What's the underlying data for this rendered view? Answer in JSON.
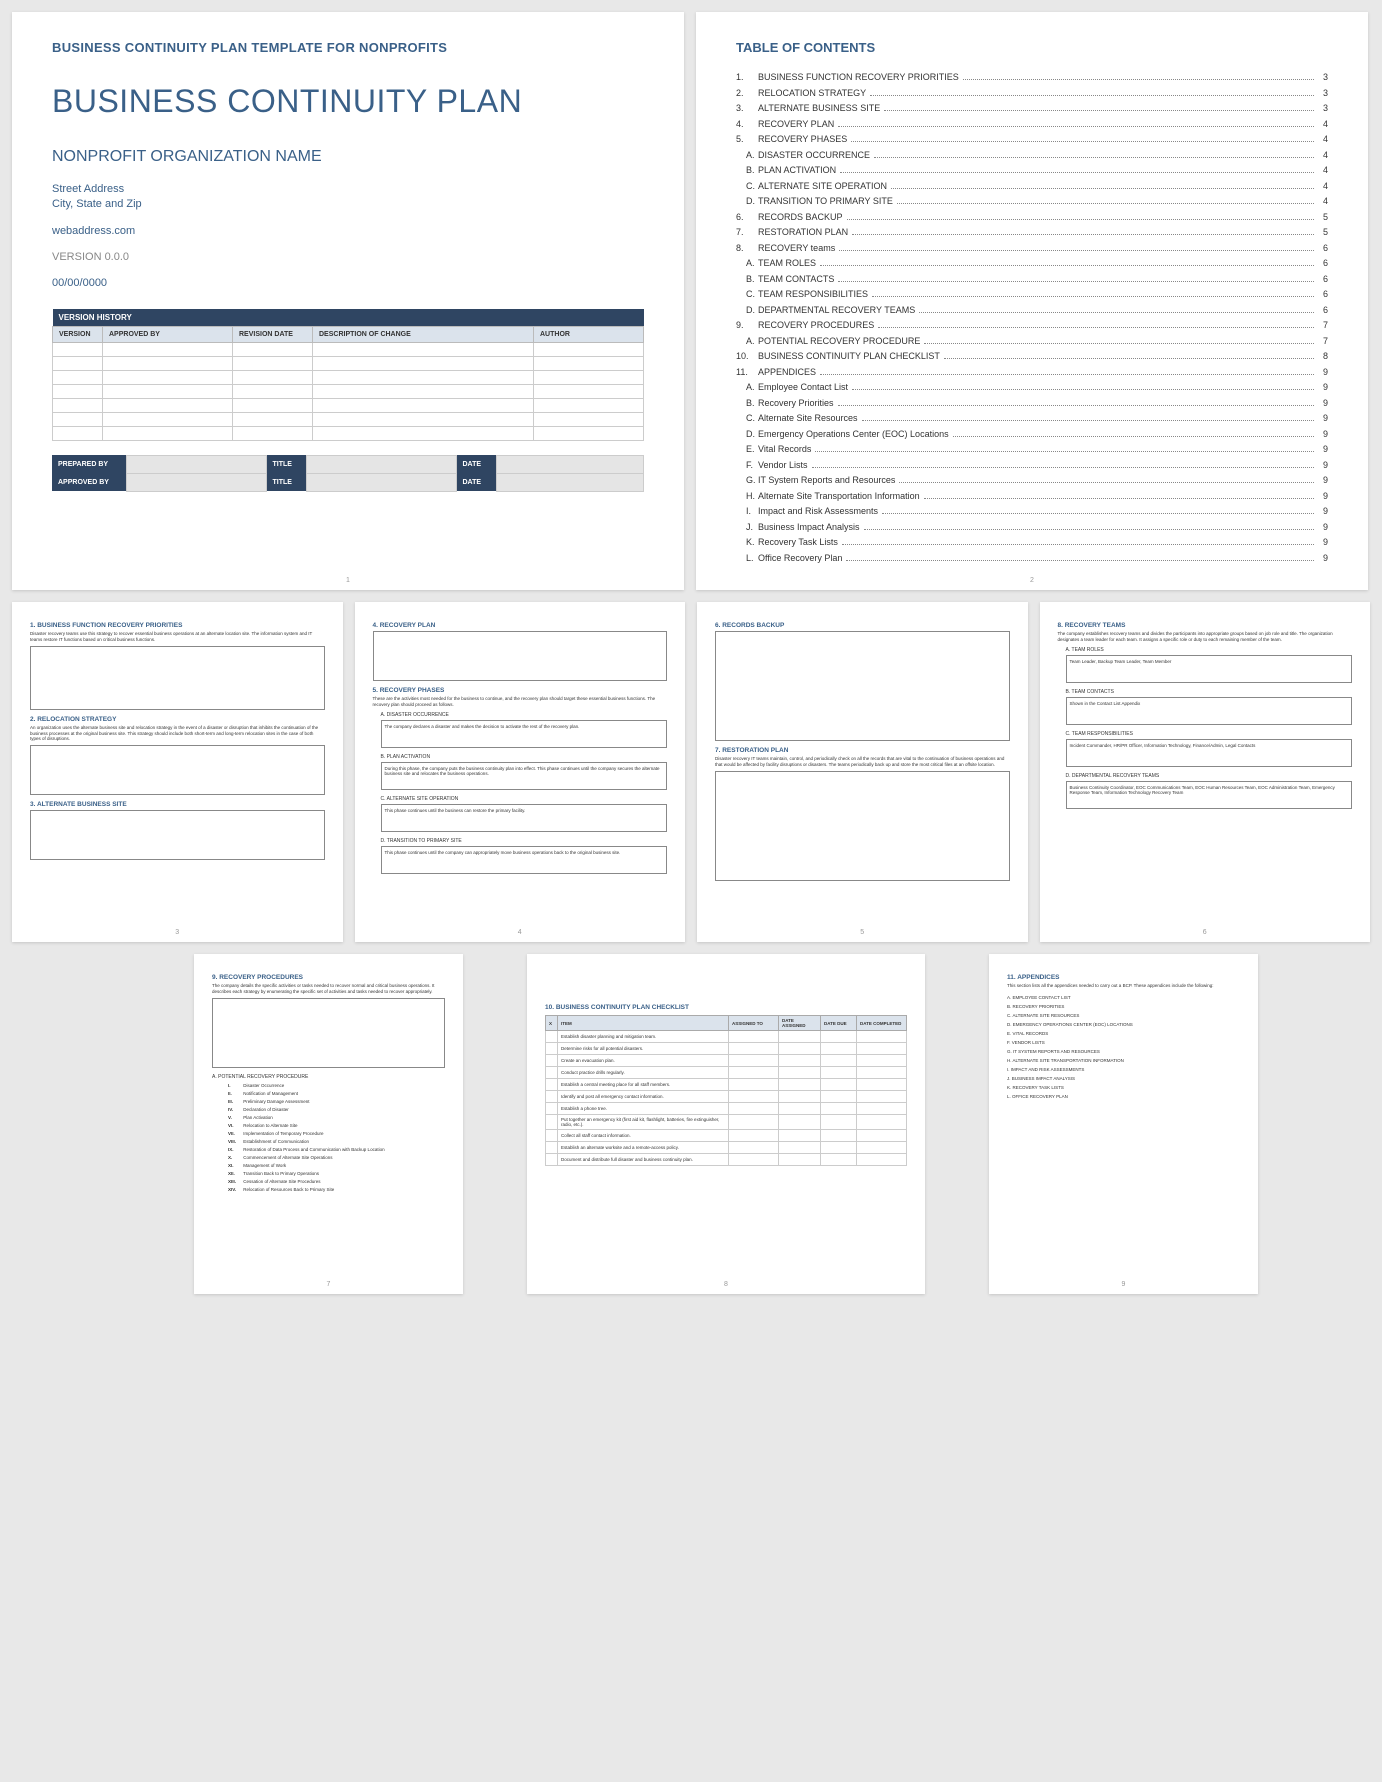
{
  "cover": {
    "header": "BUSINESS CONTINUITY PLAN TEMPLATE FOR NONPROFITS",
    "title": "BUSINESS CONTINUITY PLAN",
    "org": "NONPROFIT ORGANIZATION NAME",
    "addr1": "Street Address",
    "addr2": "City, State and Zip",
    "web": "webaddress.com",
    "version": "VERSION 0.0.0",
    "date": "00/00/0000",
    "vh_title": "VERSION HISTORY",
    "vh_cols": {
      "c1": "VERSION",
      "c2": "APPROVED BY",
      "c3": "REVISION DATE",
      "c4": "DESCRIPTION OF CHANGE",
      "c5": "AUTHOR"
    },
    "sig": {
      "prep": "PREPARED BY",
      "appr": "APPROVED BY",
      "title": "TITLE",
      "date": "DATE"
    },
    "page": "1"
  },
  "toc": {
    "title": "TABLE OF CONTENTS",
    "page": "2",
    "items": [
      {
        "n": "1.",
        "l": "BUSINESS FUNCTION RECOVERY PRIORITIES",
        "p": "3"
      },
      {
        "n": "2.",
        "l": "RELOCATION STRATEGY",
        "p": "3"
      },
      {
        "n": "3.",
        "l": "ALTERNATE BUSINESS SITE",
        "p": "3"
      },
      {
        "n": "4.",
        "l": "RECOVERY PLAN",
        "p": "4"
      },
      {
        "n": "5.",
        "l": "RECOVERY PHASES",
        "p": "4"
      },
      {
        "s": "A.",
        "l": "DISASTER OCCURRENCE",
        "p": "4"
      },
      {
        "s": "B.",
        "l": "PLAN ACTIVATION",
        "p": "4"
      },
      {
        "s": "C.",
        "l": "ALTERNATE SITE OPERATION",
        "p": "4"
      },
      {
        "s": "D.",
        "l": "TRANSITION TO PRIMARY SITE",
        "p": "4"
      },
      {
        "n": "6.",
        "l": "RECORDS BACKUP",
        "p": "5"
      },
      {
        "n": "7.",
        "l": "RESTORATION PLAN",
        "p": "5"
      },
      {
        "n": "8.",
        "l": "RECOVERY teams",
        "p": "6"
      },
      {
        "s": "A.",
        "l": "TEAM ROLES",
        "p": "6"
      },
      {
        "s": "B.",
        "l": "TEAM CONTACTS",
        "p": "6"
      },
      {
        "s": "C.",
        "l": "TEAM RESPONSIBILITIES",
        "p": "6"
      },
      {
        "s": "D.",
        "l": "DEPARTMENTAL RECOVERY TEAMS",
        "p": "6"
      },
      {
        "n": "9.",
        "l": "RECOVERY PROCEDURES",
        "p": "7"
      },
      {
        "s": "A.",
        "l": "POTENTIAL RECOVERY PROCEDURE",
        "p": "7"
      },
      {
        "n": "10.",
        "l": "BUSINESS CONTINUITY PLAN CHECKLIST",
        "p": "8"
      },
      {
        "n": "11.",
        "l": "APPENDICES",
        "p": "9"
      },
      {
        "s": "A.",
        "l": "Employee Contact List",
        "p": "9"
      },
      {
        "s": "B.",
        "l": "Recovery Priorities",
        "p": "9"
      },
      {
        "s": "C.",
        "l": "Alternate Site Resources",
        "p": "9"
      },
      {
        "s": "D.",
        "l": "Emergency Operations Center (EOC) Locations",
        "p": "9"
      },
      {
        "s": "E.",
        "l": "Vital Records",
        "p": "9"
      },
      {
        "s": "F.",
        "l": "Vendor Lists",
        "p": "9"
      },
      {
        "s": "G.",
        "l": "IT System Reports and Resources",
        "p": "9"
      },
      {
        "s": "H.",
        "l": "Alternate Site Transportation Information",
        "p": "9"
      },
      {
        "s": "I.",
        "l": "Impact and Risk Assessments",
        "p": "9"
      },
      {
        "s": "J.",
        "l": "Business Impact Analysis",
        "p": "9"
      },
      {
        "s": "K.",
        "l": "Recovery Task Lists",
        "p": "9"
      },
      {
        "s": "L.",
        "l": "Office Recovery Plan",
        "p": "9"
      }
    ]
  },
  "p3": {
    "s1": {
      "t": "1. BUSINESS FUNCTION RECOVERY PRIORITIES",
      "d": "Disaster recovery teams use this strategy to recover essential business operations at an alternate location site. The information system and IT teams restore IT functions based on critical business functions."
    },
    "s2": {
      "t": "2. RELOCATION STRATEGY",
      "d": "An organization uses the alternate business site and relocation strategy in the event of a disaster or disruption that inhibits the continuation of the business processes at the original business site. This strategy should include both short-term and long-term relocation sites in the case of both types of disruptions."
    },
    "s3": {
      "t": "3. ALTERNATE BUSINESS SITE"
    },
    "page": "3"
  },
  "p4": {
    "s4": {
      "t": "4. RECOVERY PLAN"
    },
    "s5": {
      "t": "5. RECOVERY PHASES",
      "d": "These are the activities most needed for the business to continue, and the recovery plan should target these essential business functions. The recovery plan should proceed as follows."
    },
    "a": {
      "t": "A. DISASTER OCCURRENCE",
      "d": "The company declares a disaster and makes the decision to activate the rest of the recovery plan."
    },
    "b": {
      "t": "B. PLAN ACTIVATION",
      "d": "During this phase, the company puts the business continuity plan into effect. This phase continues until the company secures the alternate business site and relocates the business operations."
    },
    "c": {
      "t": "C. ALTERNATE SITE OPERATION",
      "d": "This phase continues until the business can restore the primary facility."
    },
    "dd": {
      "t": "D. TRANSITION TO PRIMARY SITE",
      "d": "This phase continues until the company can appropriately move business operations back to the original business site."
    },
    "page": "4"
  },
  "p5": {
    "s6": {
      "t": "6. RECORDS BACKUP"
    },
    "s7": {
      "t": "7. RESTORATION PLAN",
      "d": "Disaster recovery IT teams maintain, control, and periodically check on all the records that are vital to the continuation of business operations and that would be affected by facility disruptions or disasters. The teams periodically back up and store the most critical files at an offsite location."
    },
    "page": "5"
  },
  "p6": {
    "s8": {
      "t": "8. RECOVERY TEAMS",
      "d": "The company establishes recovery teams and divides the participants into appropriate groups based on job role and title. The organization designates a team leader for each team. It assigns a specific role or duty to each remaining member of the team."
    },
    "a": {
      "t": "A. TEAM ROLES",
      "d": "Team Leader, Backup Team Leader, Team Member"
    },
    "b": {
      "t": "B. TEAM CONTACTS",
      "d": "Shown in the Contact List Appendix"
    },
    "c": {
      "t": "C. TEAM RESPONSIBILITIES",
      "d": "Incident Commander, HR/PR Officer, Information Technology, Finance/Admin, Legal Contacts"
    },
    "dd": {
      "t": "D. DEPARTMENTAL RECOVERY TEAMS",
      "d": "Business Continuity Coordinator, EOC Communications Team, EOC Human Resources Team, EOC Administration Team, Emergency Response Team, Information Technology Recovery Team"
    },
    "page": "6"
  },
  "p7": {
    "s9": {
      "t": "9. RECOVERY PROCEDURES",
      "d": "The company details the specific activities or tasks needed to recover normal and critical business operations. It describes each strategy by enumerating the specific set of activities and tasks needed to recover appropriately."
    },
    "sa": {
      "t": "A. POTENTIAL RECOVERY PROCEDURE"
    },
    "steps": [
      {
        "n": "I.",
        "l": "Disaster Occurrence"
      },
      {
        "n": "II.",
        "l": "Notification of Management"
      },
      {
        "n": "III.",
        "l": "Preliminary Damage Assessment"
      },
      {
        "n": "IV.",
        "l": "Declaration of Disaster"
      },
      {
        "n": "V.",
        "l": "Plan Activation"
      },
      {
        "n": "VI.",
        "l": "Relocation to Alternate Site"
      },
      {
        "n": "VII.",
        "l": "Implementation of Temporary Procedure"
      },
      {
        "n": "VIII.",
        "l": "Establishment of Communication"
      },
      {
        "n": "IX.",
        "l": "Restoration of Data Process and Communication with Backup Location"
      },
      {
        "n": "X.",
        "l": "Commencement of Alternate Site Operations"
      },
      {
        "n": "XI.",
        "l": "Management of Work"
      },
      {
        "n": "XII.",
        "l": "Transition Back to Primary Operations"
      },
      {
        "n": "XIII.",
        "l": "Cessation of Alternate Site Procedures"
      },
      {
        "n": "XIV.",
        "l": "Relocation of Resources Back to Primary Site"
      }
    ],
    "page": "7"
  },
  "p8": {
    "s10": {
      "t": "10. BUSINESS CONTINUITY PLAN CHECKLIST"
    },
    "cols": {
      "c0": "X",
      "c1": "ITEM",
      "c2": "ASSIGNED TO",
      "c3": "DATE ASSIGNED",
      "c4": "DATE DUE",
      "c5": "DATE COMPLETED"
    },
    "rows": [
      "Establish disaster planning and mitigation team.",
      "Determine risks for all potential disasters.",
      "Create an evacuation plan.",
      "Conduct practice drills regularly.",
      "Establish a central meeting place for all staff members.",
      "Identify and post all emergency contact information.",
      "Establish a phone tree.",
      "Put together an emergency kit (first aid kit, flashlight, batteries, fire extinguisher, radio, etc.).",
      "Collect all staff contact information.",
      "Establish an alternate worksite and a remote-access policy.",
      "Document and distribute full disaster and business continuity plan."
    ],
    "page": "8"
  },
  "p9": {
    "s11": {
      "t": "11. APPENDICES",
      "d": "This section lists all the appendices needed to carry out a BCP. These appendices include the following:"
    },
    "items": [
      "A. EMPLOYEE CONTACT LIST",
      "B. RECOVERY PRIORITIES",
      "C. ALTERNATE SITE RESOURCES",
      "D. EMERGENCY OPERATIONS CENTER (EOC) LOCATIONS",
      "E. VITAL RECORDS",
      "F. VENDOR LISTS",
      "G. IT SYSTEM REPORTS AND RESOURCES",
      "H. ALTERNATE SITE TRANSPORTATION INFORMATION",
      "I. IMPACT AND RISK ASSESSMENTS",
      "J. BUSINESS IMPACT ANALYSIS",
      "K. RECOVERY TASK LISTS",
      "L. OFFICE RECOVERY PLAN"
    ],
    "page": "9"
  }
}
